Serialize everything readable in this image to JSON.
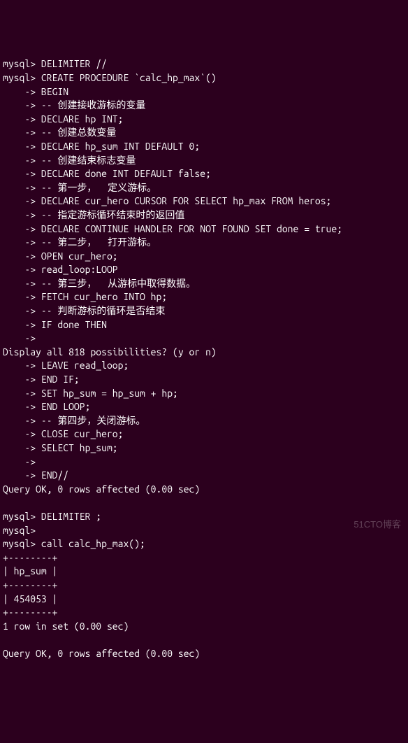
{
  "lines": [
    "mysql> DELIMITER //",
    "mysql> CREATE PROCEDURE `calc_hp_max`()",
    "    -> BEGIN",
    "    -> -- 创建接收游标的变量",
    "    -> DECLARE hp INT;",
    "    -> -- 创建总数变量",
    "    -> DECLARE hp_sum INT DEFAULT 0;",
    "    -> -- 创建结束标志变量",
    "    -> DECLARE done INT DEFAULT false;",
    "    -> -- 第一步，  定义游标。",
    "    -> DECLARE cur_hero CURSOR FOR SELECT hp_max FROM heros;",
    "    -> -- 指定游标循环结束时的返回值",
    "    -> DECLARE CONTINUE HANDLER FOR NOT FOUND SET done = true;",
    "    -> -- 第二步，  打开游标。",
    "    -> OPEN cur_hero;",
    "    -> read_loop:LOOP",
    "    -> -- 第三步，  从游标中取得数据。",
    "    -> FETCH cur_hero INTO hp;",
    "    -> -- 判断游标的循环是否结束",
    "    -> IF done THEN",
    "    ->",
    "Display all 818 possibilities? (y or n)",
    "    -> LEAVE read_loop;",
    "    -> END IF;",
    "    -> SET hp_sum = hp_sum + hp;",
    "    -> END LOOP;",
    "    -> -- 第四步，关闭游标。",
    "    -> CLOSE cur_hero;",
    "    -> SELECT hp_sum;",
    "    ->",
    "    -> END//",
    "Query OK, 0 rows affected (0.00 sec)",
    "",
    "mysql> DELIMITER ;",
    "mysql>",
    "mysql> call calc_hp_max();",
    "+--------+",
    "| hp_sum |",
    "+--------+",
    "| 454053 |",
    "+--------+",
    "1 row in set (0.00 sec)",
    "",
    "Query OK, 0 rows affected (0.00 sec)"
  ],
  "watermark": "51CTO博客"
}
